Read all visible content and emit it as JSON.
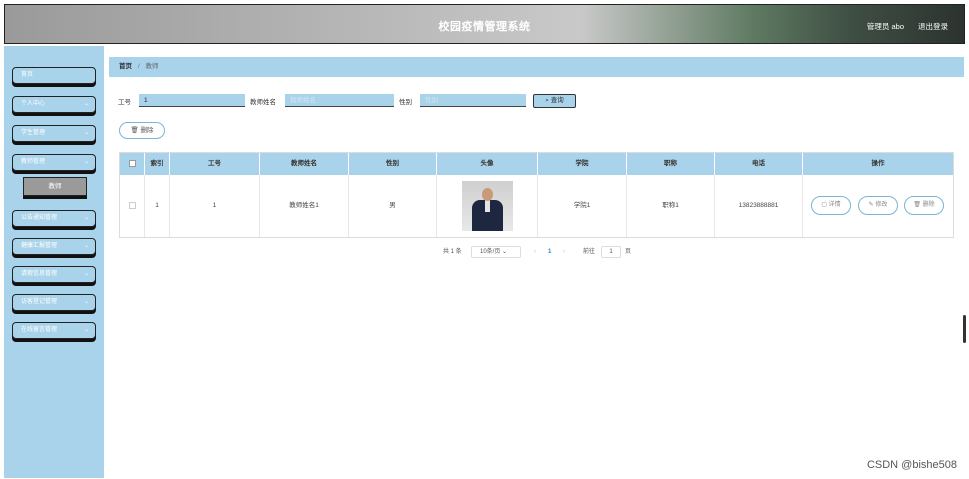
{
  "header": {
    "title": "校园疫情管理系统",
    "admin_label": "管理员 abo",
    "logout_label": "退出登录"
  },
  "sidebar": {
    "items": [
      {
        "label": "首页",
        "has_chevron": false
      },
      {
        "label": "个人中心",
        "has_chevron": true
      },
      {
        "label": "学生管理",
        "has_chevron": true
      },
      {
        "label": "教师管理",
        "has_chevron": true
      },
      {
        "label": "公告通知管理",
        "has_chevron": true
      },
      {
        "label": "健康汇报管理",
        "has_chevron": true
      },
      {
        "label": "请假信息管理",
        "has_chevron": true
      },
      {
        "label": "访客登记管理",
        "has_chevron": true
      },
      {
        "label": "在线留言管理",
        "has_chevron": true
      }
    ],
    "subitem": {
      "label": "教师"
    },
    "chevron_glyph": "⌄"
  },
  "breadcrumb": {
    "home": "首页",
    "separator": "/",
    "current": "教师"
  },
  "search": {
    "id_label": "工号",
    "id_value": "1",
    "name_label": "教师姓名",
    "name_placeholder": "教师姓名",
    "gender_label": "性别",
    "gender_placeholder": "性别",
    "button_label": "⌕ 查询"
  },
  "actions": {
    "delete_label": "🗑 删除"
  },
  "table": {
    "columns": [
      "索引",
      "工号",
      "教师姓名",
      "性别",
      "头像",
      "学院",
      "职称",
      "电话",
      "操作"
    ],
    "rows": [
      {
        "index": "1",
        "id": "1",
        "name": "教师姓名1",
        "gender": "男",
        "college": "学院1",
        "title": "职称1",
        "phone": "13823888881"
      }
    ],
    "row_buttons": {
      "detail": "▢ 详情",
      "edit": "✎ 修改",
      "delete": "🗑 删除"
    }
  },
  "pagination": {
    "total": "共 1 条",
    "page_size": "10条/页 ⌄",
    "prev": "‹",
    "current_page": "1",
    "next": "›",
    "goto_label": "前往",
    "goto_value": "1",
    "page_suffix": "页"
  },
  "watermark": "CSDN @bishe508",
  "colors": {
    "sidebar_bg": "#a9d3ea",
    "accent_border": "#7ab4d6",
    "page_active": "#1e88c8"
  }
}
